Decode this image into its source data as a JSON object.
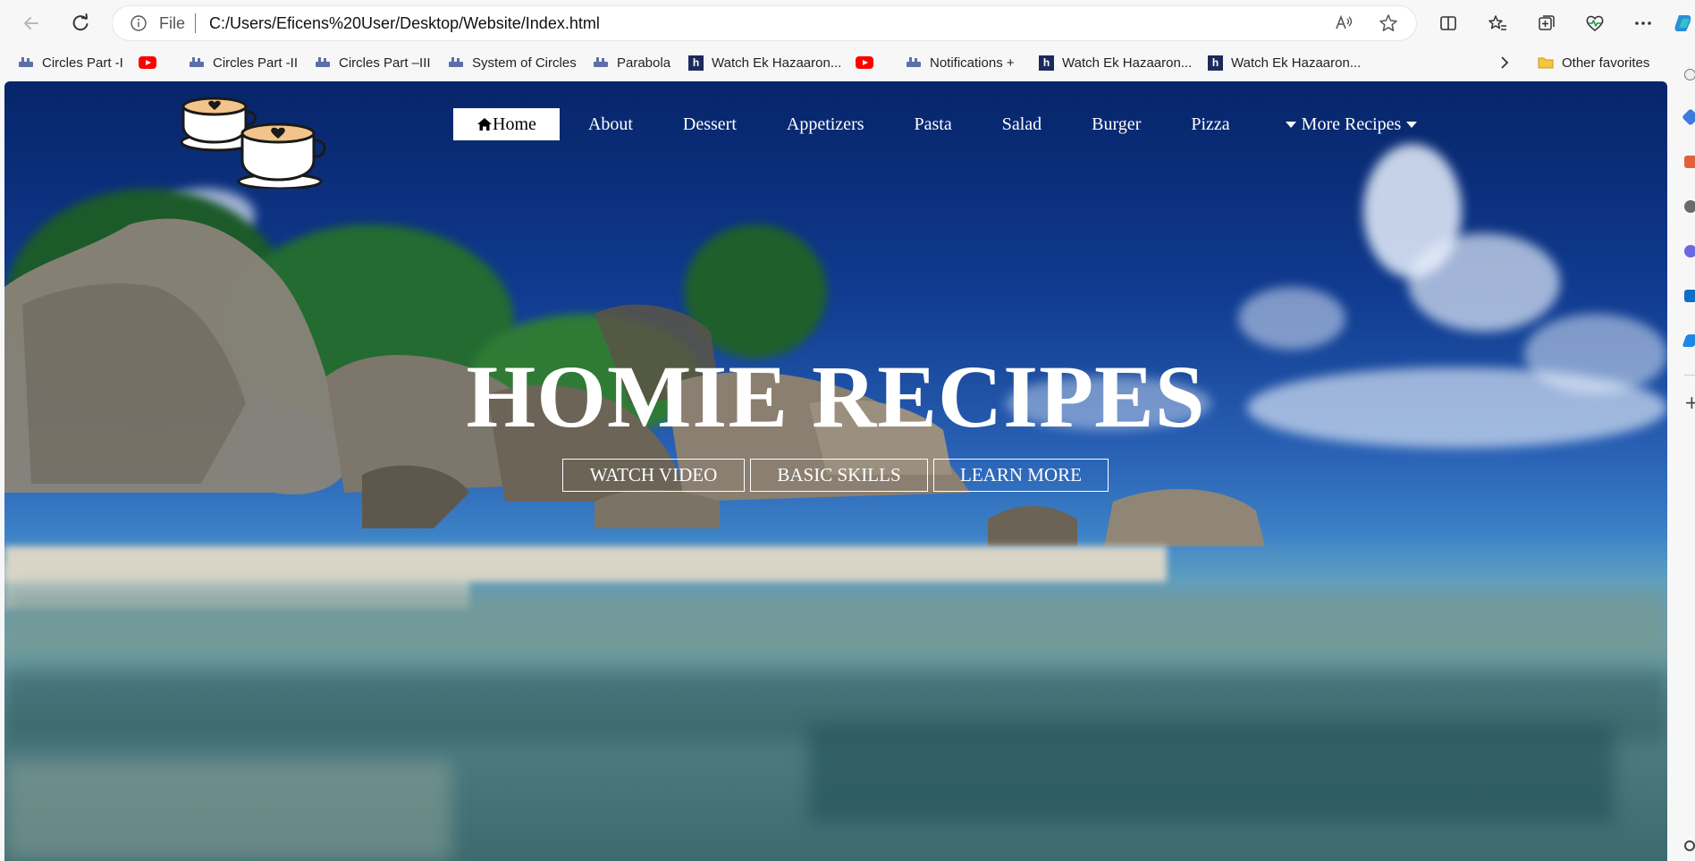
{
  "browser": {
    "address": {
      "scheme_label": "File",
      "url": "C:/Users/Eficens%20User/Desktop/Website/Index.html"
    }
  },
  "bookmarks": {
    "items": [
      {
        "label": "Circles Part -I",
        "icon": "site-icon"
      },
      {
        "label": "",
        "icon": "youtube-icon"
      },
      {
        "label": "Circles Part -II",
        "icon": "site-icon"
      },
      {
        "label": "Circles Part –III",
        "icon": "site-icon"
      },
      {
        "label": "System of Circles",
        "icon": "site-icon"
      },
      {
        "label": "Parabola",
        "icon": "site-icon"
      },
      {
        "label": "Watch Ek Hazaaron...",
        "icon": "h-icon"
      },
      {
        "label": "",
        "icon": "youtube-icon"
      },
      {
        "label": "Notifications +",
        "icon": "site-icon"
      },
      {
        "label": "Watch Ek Hazaaron...",
        "icon": "h-icon"
      },
      {
        "label": "Watch Ek Hazaaron...",
        "icon": "h-icon"
      }
    ],
    "other_favorites": "Other favorites"
  },
  "site": {
    "nav": {
      "home": "Home",
      "about": "About",
      "dessert": "Dessert",
      "appetizers": "Appetizers",
      "pasta": "Pasta",
      "salad": "Salad",
      "burger": "Burger",
      "pizza": "Pizza",
      "more": "More Recipes"
    },
    "hero": {
      "title": "HOMIE RECIPES",
      "buttons": {
        "watch": "WATCH VIDEO",
        "skills": "BASIC SKILLS",
        "learn": "LEARN MORE"
      }
    }
  },
  "colors": {
    "menu_active_bg": "#ffffff",
    "text_light": "#ffffff",
    "logo_fill": "#f2c38a",
    "logo_stroke": "#1a1a1a"
  }
}
